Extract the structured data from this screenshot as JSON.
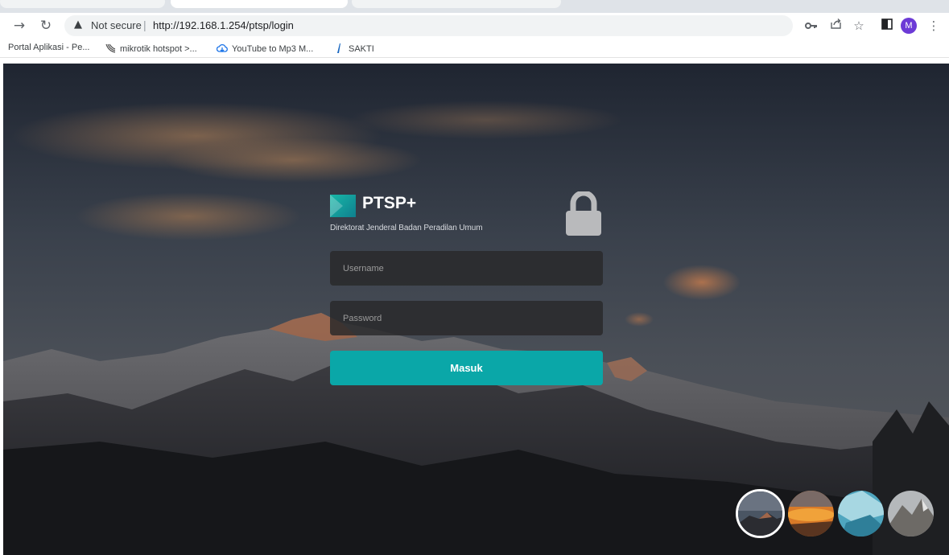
{
  "browser": {
    "security_label": "Not secure",
    "url": "http://192.168.1.254/ptsp/login",
    "profile_initial": "M",
    "icons": [
      "forward-icon",
      "reload-icon",
      "warning-icon",
      "key-icon",
      "share-icon",
      "star-icon",
      "sidebar-icon",
      "menu-icon"
    ]
  },
  "bookmarks": [
    {
      "label": "Portal Aplikasi - Pe..."
    },
    {
      "label": "mikrotik hotspot >..."
    },
    {
      "label": "YouTube to Mp3 M..."
    },
    {
      "label": "SAKTI"
    }
  ],
  "login": {
    "brand_name": "PTSP+",
    "brand_subtitle": "Direktorat Jenderal Badan Peradilan Umum",
    "username_placeholder": "Username",
    "password_placeholder": "Password",
    "submit_label": "Masuk",
    "accent_color": "#0aa7a8"
  },
  "background_selector": {
    "options": [
      "mountain-dusk",
      "sunset-clouds",
      "icy-water",
      "rocky-peaks"
    ],
    "selected_index": 0
  }
}
